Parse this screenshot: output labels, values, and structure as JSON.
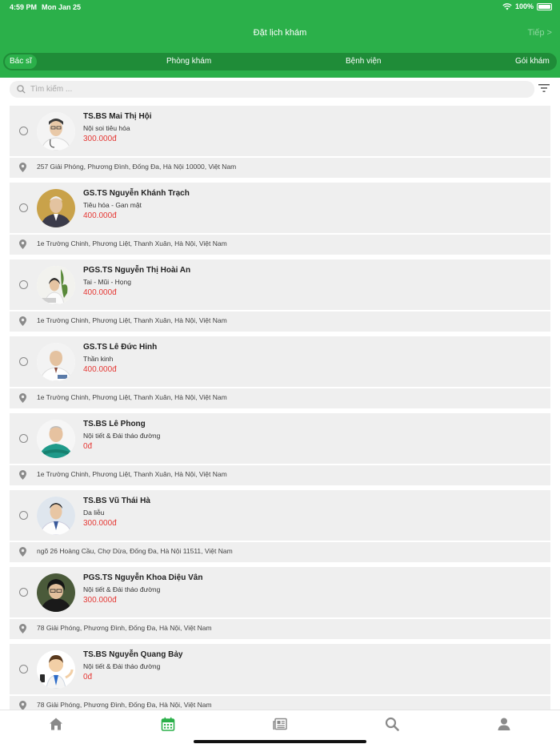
{
  "status": {
    "time": "4:59 PM",
    "date": "Mon Jan 25",
    "battery": "100%"
  },
  "nav": {
    "title": "Đặt lịch khám",
    "next_label": "Tiếp >"
  },
  "tabs": [
    {
      "label": "Bác sĩ",
      "active": true
    },
    {
      "label": "Phòng khám",
      "active": false
    },
    {
      "label": "Bệnh viện",
      "active": false
    },
    {
      "label": "Gói khám",
      "active": false
    }
  ],
  "search": {
    "placeholder": "Tìm kiếm ..."
  },
  "doctors": [
    {
      "name": "TS.BS Mai Thị Hội",
      "specialty": "Nội soi tiêu hóa",
      "price": "300.000đ",
      "address": "257 Giải Phóng, Phương Đình, Đống Đa, Hà Nội 10000, Việt Nam"
    },
    {
      "name": "GS.TS Nguyễn Khánh Trạch",
      "specialty": "Tiêu hóa - Gan mật",
      "price": "400.000đ",
      "address": "1e Trường Chinh, Phương Liệt, Thanh Xuân, Hà Nội, Việt Nam"
    },
    {
      "name": "PGS.TS Nguyễn Thị Hoài An",
      "specialty": "Tai - Mũi - Họng",
      "price": "400.000đ",
      "address": "1e Trường Chinh, Phương Liệt, Thanh Xuân, Hà Nội, Việt Nam"
    },
    {
      "name": "GS.TS Lê Đức Hinh",
      "specialty": "Thần kinh",
      "price": "400.000đ",
      "address": "1e Trường Chinh, Phương Liệt, Thanh Xuân, Hà Nội, Việt Nam"
    },
    {
      "name": "TS.BS Lê Phong",
      "specialty": "Nội tiết & Đái tháo đường",
      "price": "0đ",
      "address": "1e Trường Chinh, Phương Liệt, Thanh Xuân, Hà Nội, Việt Nam"
    },
    {
      "name": "TS.BS Vũ Thái Hà",
      "specialty": "Da liễu",
      "price": "300.000đ",
      "address": "ngõ 26 Hoàng Cầu, Chợ Dừa, Đống Đa, Hà Nội 11511, Việt Nam"
    },
    {
      "name": "PGS.TS Nguyễn Khoa Diệu Vân",
      "specialty": "Nội tiết & Đái tháo đường",
      "price": "300.000đ",
      "address": "78 Giải Phóng, Phương Đình, Đống Đa, Hà Nội, Việt Nam"
    },
    {
      "name": "TS.BS Nguyễn Quang Bảy",
      "specialty": "Nội tiết & Đái tháo đường",
      "price": "0đ",
      "address": "78 Giải Phóng, Phương Đình, Đống Đa, Hà Nội, Việt Nam"
    }
  ],
  "bottom_tabs": [
    {
      "icon": "home-icon",
      "active": false
    },
    {
      "icon": "calendar-icon",
      "active": true
    },
    {
      "icon": "news-icon",
      "active": false
    },
    {
      "icon": "search-icon",
      "active": false
    },
    {
      "icon": "user-icon",
      "active": false
    }
  ],
  "colors": {
    "primary": "#2bb04a",
    "primary_dark": "#1f8c38",
    "price": "#e53935",
    "card": "#efefef",
    "tab_inactive": "#8a8a8a"
  }
}
